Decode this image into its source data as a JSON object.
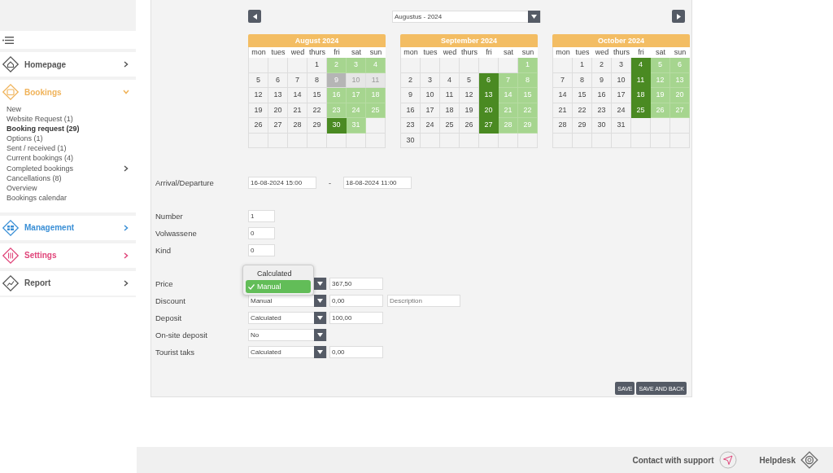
{
  "sidebar": {
    "items": [
      {
        "label": "Homepage",
        "color": "#555555",
        "expanded": false
      },
      {
        "label": "Bookings",
        "color": "#f0b35a",
        "expanded": true,
        "children": [
          {
            "label": "New",
            "selected": false,
            "has_submenu": false
          },
          {
            "label": "Website Request (1)",
            "selected": false,
            "has_submenu": false
          },
          {
            "label": "Booking request (29)",
            "selected": true,
            "has_submenu": false
          },
          {
            "label": "Options (1)",
            "selected": false,
            "has_submenu": false
          },
          {
            "label": "Sent / received (1)",
            "selected": false,
            "has_submenu": false
          },
          {
            "label": "Current bookings (4)",
            "selected": false,
            "has_submenu": false
          },
          {
            "label": "Completed bookings",
            "selected": false,
            "has_submenu": true
          },
          {
            "label": "Cancellations (8)",
            "selected": false,
            "has_submenu": false
          },
          {
            "label": "Overview",
            "selected": false,
            "has_submenu": false
          },
          {
            "label": "Bookings calendar",
            "selected": false,
            "has_submenu": false
          }
        ]
      },
      {
        "label": "Management",
        "color": "#3a8fd6",
        "expanded": false
      },
      {
        "label": "Settings",
        "color": "#e0457a",
        "expanded": false
      },
      {
        "label": "Report",
        "color": "#555555",
        "expanded": false
      }
    ]
  },
  "month_picker": {
    "value": "Augustus - 2024"
  },
  "months": [
    {
      "title": "August 2024",
      "weekdays": [
        "mon",
        "tues",
        "wed",
        "thurs",
        "fri",
        "sat",
        "sun"
      ],
      "weeks": [
        [
          {
            "kind": "empty"
          },
          {
            "kind": "empty"
          },
          {
            "kind": "empty"
          },
          {
            "d": "1",
            "kind": "plain"
          },
          {
            "d": "2",
            "kind": "free"
          },
          {
            "d": "3",
            "kind": "free"
          },
          {
            "d": "4",
            "kind": "free"
          }
        ],
        [
          {
            "d": "5",
            "kind": "plain"
          },
          {
            "d": "6",
            "kind": "plain"
          },
          {
            "d": "7",
            "kind": "plain"
          },
          {
            "d": "8",
            "kind": "plain"
          },
          {
            "d": "9",
            "kind": "selected"
          },
          {
            "d": "10",
            "kind": "blocked"
          },
          {
            "d": "11",
            "kind": "blocked"
          }
        ],
        [
          {
            "d": "12",
            "kind": "plain"
          },
          {
            "d": "13",
            "kind": "plain"
          },
          {
            "d": "14",
            "kind": "plain"
          },
          {
            "d": "15",
            "kind": "plain"
          },
          {
            "d": "16",
            "kind": "free"
          },
          {
            "d": "17",
            "kind": "free"
          },
          {
            "d": "18",
            "kind": "free"
          }
        ],
        [
          {
            "d": "19",
            "kind": "plain"
          },
          {
            "d": "20",
            "kind": "plain"
          },
          {
            "d": "21",
            "kind": "plain"
          },
          {
            "d": "22",
            "kind": "plain"
          },
          {
            "d": "23",
            "kind": "free"
          },
          {
            "d": "24",
            "kind": "free"
          },
          {
            "d": "25",
            "kind": "free"
          }
        ],
        [
          {
            "d": "26",
            "kind": "plain"
          },
          {
            "d": "27",
            "kind": "plain"
          },
          {
            "d": "28",
            "kind": "plain"
          },
          {
            "d": "29",
            "kind": "plain"
          },
          {
            "d": "30",
            "kind": "booked"
          },
          {
            "d": "31",
            "kind": "free"
          },
          {
            "kind": "empty"
          }
        ],
        [
          {
            "kind": "empty"
          },
          {
            "kind": "empty"
          },
          {
            "kind": "empty"
          },
          {
            "kind": "empty"
          },
          {
            "kind": "empty"
          },
          {
            "kind": "empty"
          },
          {
            "kind": "empty"
          }
        ]
      ]
    },
    {
      "title": "September 2024",
      "weekdays": [
        "mon",
        "tues",
        "wed",
        "thurs",
        "fri",
        "sat",
        "sun"
      ],
      "weeks": [
        [
          {
            "kind": "empty"
          },
          {
            "kind": "empty"
          },
          {
            "kind": "empty"
          },
          {
            "kind": "empty"
          },
          {
            "kind": "empty"
          },
          {
            "kind": "empty"
          },
          {
            "d": "1",
            "kind": "free"
          }
        ],
        [
          {
            "d": "2",
            "kind": "plain"
          },
          {
            "d": "3",
            "kind": "plain"
          },
          {
            "d": "4",
            "kind": "plain"
          },
          {
            "d": "5",
            "kind": "plain"
          },
          {
            "d": "6",
            "kind": "booked"
          },
          {
            "d": "7",
            "kind": "free"
          },
          {
            "d": "8",
            "kind": "free"
          }
        ],
        [
          {
            "d": "9",
            "kind": "plain"
          },
          {
            "d": "10",
            "kind": "plain"
          },
          {
            "d": "11",
            "kind": "plain"
          },
          {
            "d": "12",
            "kind": "plain"
          },
          {
            "d": "13",
            "kind": "booked"
          },
          {
            "d": "14",
            "kind": "free"
          },
          {
            "d": "15",
            "kind": "free"
          }
        ],
        [
          {
            "d": "16",
            "kind": "plain"
          },
          {
            "d": "17",
            "kind": "plain"
          },
          {
            "d": "18",
            "kind": "plain"
          },
          {
            "d": "19",
            "kind": "plain"
          },
          {
            "d": "20",
            "kind": "booked"
          },
          {
            "d": "21",
            "kind": "free"
          },
          {
            "d": "22",
            "kind": "free"
          }
        ],
        [
          {
            "d": "23",
            "kind": "plain"
          },
          {
            "d": "24",
            "kind": "plain"
          },
          {
            "d": "25",
            "kind": "plain"
          },
          {
            "d": "26",
            "kind": "plain"
          },
          {
            "d": "27",
            "kind": "booked"
          },
          {
            "d": "28",
            "kind": "free"
          },
          {
            "d": "29",
            "kind": "free"
          }
        ],
        [
          {
            "d": "30",
            "kind": "plain"
          },
          {
            "kind": "empty"
          },
          {
            "kind": "empty"
          },
          {
            "kind": "empty"
          },
          {
            "kind": "empty"
          },
          {
            "kind": "empty"
          },
          {
            "kind": "empty"
          }
        ]
      ]
    },
    {
      "title": "October 2024",
      "weekdays": [
        "mon",
        "tues",
        "wed",
        "thurs",
        "fri",
        "sat",
        "sun"
      ],
      "weeks": [
        [
          {
            "kind": "empty"
          },
          {
            "d": "1",
            "kind": "plain"
          },
          {
            "d": "2",
            "kind": "plain"
          },
          {
            "d": "3",
            "kind": "plain"
          },
          {
            "d": "4",
            "kind": "booked"
          },
          {
            "d": "5",
            "kind": "free"
          },
          {
            "d": "6",
            "kind": "free"
          }
        ],
        [
          {
            "d": "7",
            "kind": "plain"
          },
          {
            "d": "8",
            "kind": "plain"
          },
          {
            "d": "9",
            "kind": "plain"
          },
          {
            "d": "10",
            "kind": "plain"
          },
          {
            "d": "11",
            "kind": "booked"
          },
          {
            "d": "12",
            "kind": "free"
          },
          {
            "d": "13",
            "kind": "free"
          }
        ],
        [
          {
            "d": "14",
            "kind": "plain"
          },
          {
            "d": "15",
            "kind": "plain"
          },
          {
            "d": "16",
            "kind": "plain"
          },
          {
            "d": "17",
            "kind": "plain"
          },
          {
            "d": "18",
            "kind": "booked"
          },
          {
            "d": "19",
            "kind": "free"
          },
          {
            "d": "20",
            "kind": "free"
          }
        ],
        [
          {
            "d": "21",
            "kind": "plain"
          },
          {
            "d": "22",
            "kind": "plain"
          },
          {
            "d": "23",
            "kind": "plain"
          },
          {
            "d": "24",
            "kind": "plain"
          },
          {
            "d": "25",
            "kind": "booked"
          },
          {
            "d": "26",
            "kind": "free"
          },
          {
            "d": "27",
            "kind": "free"
          }
        ],
        [
          {
            "d": "28",
            "kind": "plain"
          },
          {
            "d": "29",
            "kind": "plain"
          },
          {
            "d": "30",
            "kind": "plain"
          },
          {
            "d": "31",
            "kind": "plain"
          },
          {
            "kind": "empty"
          },
          {
            "kind": "empty"
          },
          {
            "kind": "empty"
          }
        ],
        [
          {
            "kind": "empty"
          },
          {
            "kind": "empty"
          },
          {
            "kind": "empty"
          },
          {
            "kind": "empty"
          },
          {
            "kind": "empty"
          },
          {
            "kind": "empty"
          },
          {
            "kind": "empty"
          }
        ]
      ]
    }
  ],
  "arrival": {
    "label": "Arrival/Departure",
    "from": "16-08-2024 15:00",
    "separator": "-",
    "to": "18-08-2024 11:00"
  },
  "guests": [
    {
      "label": "Number",
      "value": "1"
    },
    {
      "label": "Volwassene",
      "value": "0"
    },
    {
      "label": "Kind",
      "value": "0"
    }
  ],
  "costs": [
    {
      "label": "Price",
      "amount": "367,50",
      "popup": [
        {
          "label": "Calculated",
          "selected": false
        },
        {
          "label": "Manual",
          "selected": true
        }
      ]
    },
    {
      "label": "Discount",
      "mode": "Manual",
      "amount": "0,00",
      "description_placeholder": "Description"
    },
    {
      "label": "Deposit",
      "mode": "Calculated",
      "amount": "100,00"
    },
    {
      "label": "On-site deposit",
      "mode": "No"
    },
    {
      "label": "Tourist taks",
      "mode": "Calculated",
      "amount": "0,00"
    }
  ],
  "buttons": [
    "SAVE",
    "SAVE AND BACK"
  ],
  "footer": {
    "support": "Contact with support",
    "helpdesk": "Helpdesk"
  }
}
